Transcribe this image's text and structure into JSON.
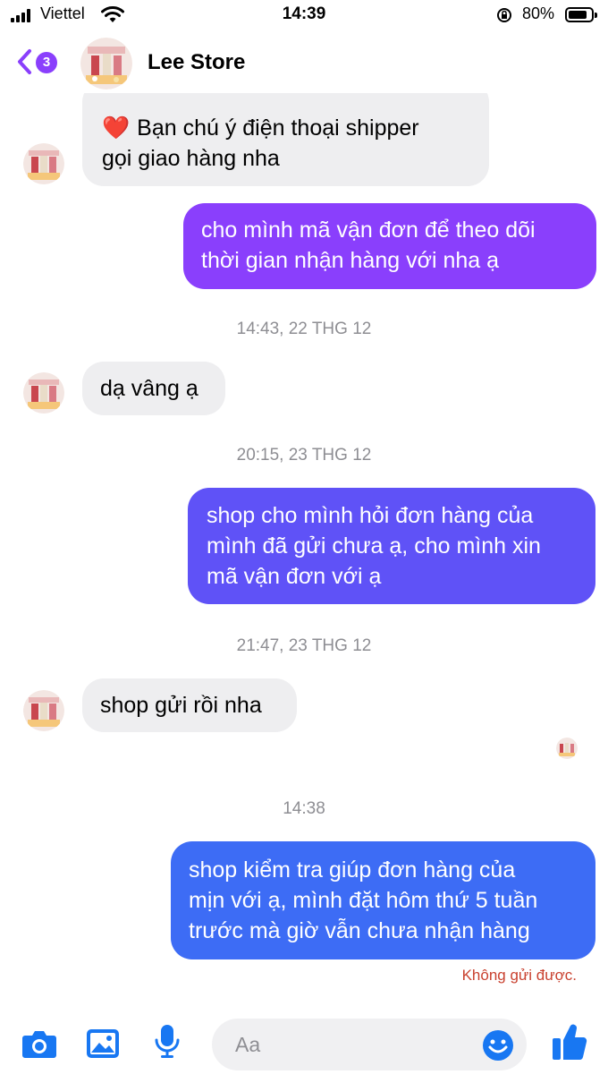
{
  "status_bar": {
    "carrier": "Viettel",
    "time": "14:39",
    "battery": "80%"
  },
  "header": {
    "unread_count": "3",
    "title": "Lee Store"
  },
  "messages": [
    {
      "id": "m1",
      "direction": "incoming",
      "text": "Bạn chú ý điện thoại shipper gọi giao hàng nha",
      "line1": "Bạn chú ý điện thoại shipper",
      "line2": "gọi giao hàng nha"
    },
    {
      "id": "m2",
      "direction": "outgoing",
      "line1": "cho mình mã vận đơn để theo dõi",
      "line2": "thời gian nhận hàng với nha ạ"
    },
    {
      "id": "t1",
      "timestamp": "14:43, 22 THG 12"
    },
    {
      "id": "m3",
      "direction": "incoming",
      "line1": "dạ vâng ạ"
    },
    {
      "id": "t2",
      "timestamp": "20:15, 23 THG 12"
    },
    {
      "id": "m4",
      "direction": "outgoing",
      "line1": "shop cho mình hỏi đơn hàng của",
      "line2": "mình đã gửi chưa ạ, cho mình xin",
      "line3": "mã vận đơn với ạ"
    },
    {
      "id": "t3",
      "timestamp": "21:47, 23 THG 12"
    },
    {
      "id": "m5",
      "direction": "incoming",
      "line1": "shop gửi rồi nha"
    },
    {
      "id": "t4",
      "timestamp": "14:38"
    },
    {
      "id": "m6",
      "direction": "outgoing",
      "line1": "shop kiểm tra giúp đơn hàng của",
      "line2": "mịn với ạ, mình đặt hôm thứ 5 tuần",
      "line3": "trước mà giờ vẫn chưa nhận hàng",
      "status": "Không gửi được."
    }
  ],
  "composer": {
    "placeholder": "Aa",
    "icons": [
      "camera-icon",
      "image-icon",
      "microphone-icon",
      "emoji-icon",
      "thumbs-up-icon"
    ]
  },
  "colors": {
    "accent": "#1877f2",
    "bubble_purple": "#8a3ffc",
    "bubble_indigo": "#5f52f7",
    "bubble_blue": "#3d6cf5",
    "incoming_bubble": "#eeeef0",
    "error_text": "#c9412f"
  }
}
